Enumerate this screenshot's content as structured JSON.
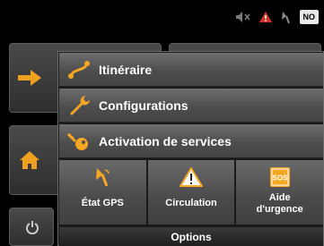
{
  "status_bar": {
    "icons": [
      "mute-icon",
      "warning-icon",
      "satellite-icon"
    ],
    "gps_badge": "NO"
  },
  "menu": {
    "items": [
      {
        "label": "Itinéraire",
        "icon": "route-icon"
      },
      {
        "label": "Configurations",
        "icon": "wrench-icon"
      },
      {
        "label": "Activation de services",
        "icon": "key-icon"
      }
    ],
    "tiles": [
      {
        "label": "État GPS",
        "icon": "satellite-icon"
      },
      {
        "label": "Circulation",
        "icon": "traffic-warning-icon"
      },
      {
        "label_line1": "Aide",
        "label_line2": "d'urgence",
        "icon": "sos-icon",
        "icon_text": "SOS"
      }
    ],
    "options_label": "Options"
  },
  "colors": {
    "accent_orange": "#f5a623",
    "menu_gradient_top": "#6e6e6e",
    "menu_gradient_bottom": "#444444"
  }
}
